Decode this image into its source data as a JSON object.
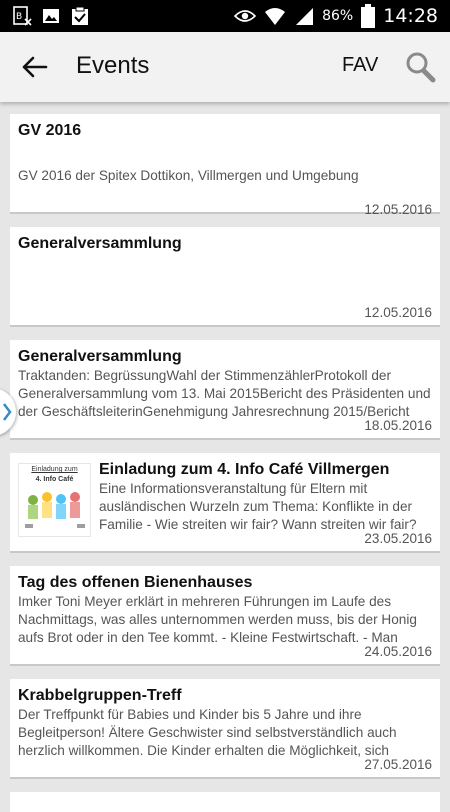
{
  "statusbar": {
    "battery_percent": "86%",
    "time": "14:28",
    "icons": [
      "sim-icon",
      "image-icon",
      "clipboard-check-icon",
      "eye-icon",
      "wifi-icon",
      "signal-icon",
      "battery-icon"
    ]
  },
  "appbar": {
    "title": "Events",
    "fav_label": "FAV"
  },
  "events": [
    {
      "title": "GV 2016",
      "description": "GV 2016 der Spitex Dottikon, Villmergen und Umgebung",
      "date": "12.05.2016"
    },
    {
      "title": "Generalversammlung",
      "description": "",
      "date": "12.05.2016"
    },
    {
      "title": "Generalversammlung",
      "description": "Traktanden: BegrüssungWahl der StimmenzählerProtokoll der Generalversammlung vom 13. Mai 2015Bericht des Präsidenten und der GeschäftsleiterinGenehmigung Jahresrechnung 2015/Bericht",
      "date": "18.05.2016"
    },
    {
      "title": "Einladung zum 4. Info Café Villmergen",
      "description": "Eine Informationsveranstaltung für Eltern mit ausländischen Wurzeln zum Thema: Konflikte in der Familie - Wie streiten wir fair? Wann streiten wir fair?",
      "date": "23.05.2016",
      "thumbnail_text": [
        "Einladung zum",
        "4. Info Café"
      ]
    },
    {
      "title": "Tag des offenen Bienenhauses",
      "description": "Imker Toni Meyer erklärt in mehreren Führungen im Laufe des Nachmittags, was alles unternommen werden muss, bis der Honig aufs Brot oder in den Tee kommt. - Kleine Festwirtschaft. - Man",
      "date": "24.05.2016"
    },
    {
      "title": "Krabbelgruppen-Treff",
      "description": "Der Treffpunkt für Babies und Kinder bis 5 Jahre und ihre Begleitperson! Ältere Geschwister sind selbstverständlich auch herzlich willkommen.   Die Kinder erhalten die Möglichkeit, sich",
      "date": "27.05.2016"
    }
  ]
}
